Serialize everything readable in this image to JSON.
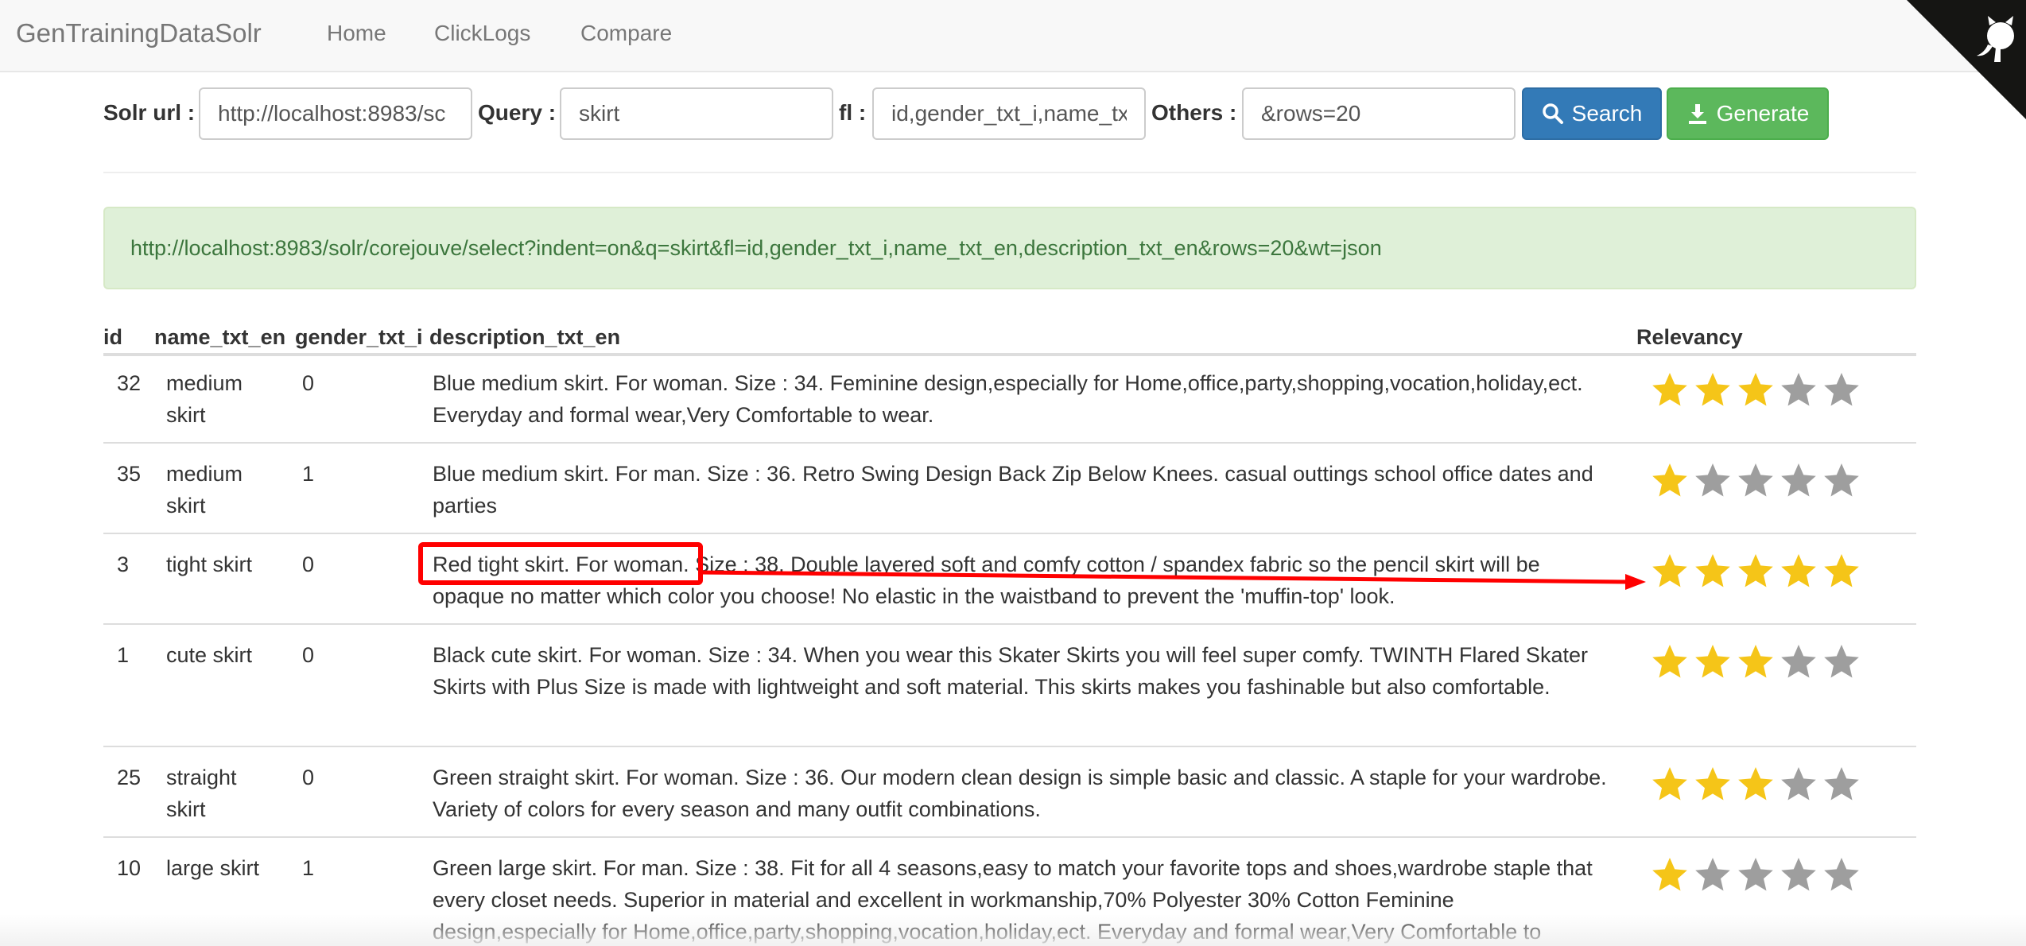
{
  "navbar": {
    "brand": "GenTrainingDataSolr",
    "links": [
      "Home",
      "ClickLogs",
      "Compare"
    ]
  },
  "form": {
    "solr_url": {
      "label": "Solr url :",
      "value": "http://localhost:8983/sc"
    },
    "query": {
      "label": "Query :",
      "value": "skirt"
    },
    "fl": {
      "label": "fl :",
      "value": "id,gender_txt_i,name_tx"
    },
    "others": {
      "label": "Others :",
      "value": "&rows=20"
    },
    "search_label": "Search",
    "generate_label": "Generate"
  },
  "alert_url": "http://localhost:8983/solr/corejouve/select?indent=on&q=skirt&fl=id,gender_txt_i,name_txt_en,description_txt_en&rows=20&wt=json",
  "table": {
    "headers": [
      "id",
      "name_txt_en",
      "gender_txt_i",
      "description_txt_en",
      "Relevancy"
    ],
    "rows": [
      {
        "id": "32",
        "name": "medium skirt",
        "gender": "0",
        "description": "Blue medium skirt. For woman. Size : 34. Feminine design,especially for Home,office,party,shopping,vocation,holiday,ect. Everyday and formal wear,Very Comfortable to wear.",
        "relevancy": 3
      },
      {
        "id": "35",
        "name": "medium skirt",
        "gender": "1",
        "description": "Blue medium skirt. For man. Size : 36. Retro Swing Design Back Zip Below Knees. casual outtings school office dates and parties",
        "relevancy": 1
      },
      {
        "id": "3",
        "name": "tight skirt",
        "gender": "0",
        "description": "Red tight skirt. For woman. Size : 38. Double layered soft and comfy cotton / spandex fabric so the pencil skirt will be opaque no matter which color you choose! No elastic in the waistband to prevent the 'muffin-top' look.",
        "relevancy": 5
      },
      {
        "id": "1",
        "name": "cute skirt",
        "gender": "0",
        "description": "Black cute skirt. For woman. Size : 34. When you wear this Skater Skirts you will feel super comfy. TWINTH Flared Skater Skirts with Plus Size is made with lightweight and soft material. This skirts makes you fashinable but also comfortable.",
        "relevancy": 3
      },
      {
        "id": "25",
        "name": "straight skirt",
        "gender": "0",
        "description": "Green straight skirt. For woman. Size : 36. Our modern clean design is simple basic and classic. A staple for your wardrobe. Variety of colors for every season and many outfit combinations.",
        "relevancy": 3
      },
      {
        "id": "10",
        "name": "large skirt",
        "gender": "1",
        "description": "Green large skirt. For man. Size : 38. Fit for all 4 seasons,easy to match your favorite tops and shoes,wardrobe staple that every closet needs. Superior in material and excellent in workmanship,70% Polyester 30% Cotton Feminine design,especially for Home,office,party,shopping,vocation,holiday,ect. Everyday and formal wear,Very Comfortable to",
        "relevancy": 1
      }
    ]
  },
  "colors": {
    "star_on": "#f5c518",
    "star_off": "#9e9e9e",
    "annotation": "#ff0000"
  },
  "icons": {
    "search": "search-icon",
    "generate": "download-icon",
    "corner": "github-octocat-icon"
  }
}
